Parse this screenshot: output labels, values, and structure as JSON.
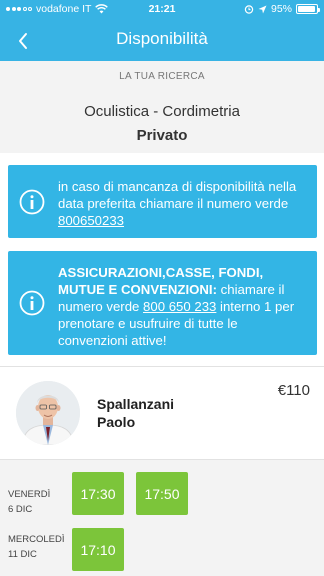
{
  "status": {
    "carrier": "vodafone IT",
    "time": "21:21",
    "battery": "95%",
    "battery_level": 0.95,
    "icons": [
      "signal-icon",
      "wifi-icon",
      "alarm-icon",
      "location-icon",
      "battery-icon"
    ]
  },
  "header": {
    "title": "Disponibilità",
    "back_icon": "chevron-left-icon"
  },
  "search": {
    "caption": "LA TUA RICERCA",
    "service": "Oculistica - Cordimetria",
    "type": "Privato"
  },
  "info_box_1": {
    "icon": "info-icon",
    "text": "in caso di mancanza di disponibilità nella data preferita chiamare il numero verde ",
    "phone": "800650233"
  },
  "info_box_2": {
    "icon": "info-icon",
    "bold_text": "ASSICURAZIONI,CASSE, FONDI, MUTUE E CONVENZIONI:",
    "text_before": " chiamare il numero verde ",
    "phone": "800 650 233",
    "text_after": " interno 1 per prenotare e usufruire di tutte le convenzioni attive!"
  },
  "doctor": {
    "first_line": "Spallanzani",
    "second_line": "Paolo",
    "price": "€110"
  },
  "days": [
    {
      "weekday": "VENERDÌ",
      "date": "6 DIC",
      "slots": [
        "17:30",
        "17:50"
      ]
    },
    {
      "weekday": "MERCOLEDÌ",
      "date": "11 DIC",
      "slots": [
        "17:10"
      ]
    }
  ],
  "colors": {
    "primary": "#37b3e4",
    "info_box": "#33b5e5",
    "slot": "#7cc53a",
    "summary_bg": "#f3f3f3"
  }
}
